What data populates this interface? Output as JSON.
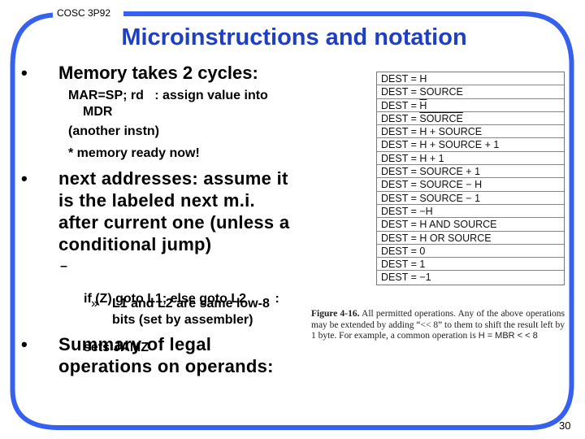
{
  "header": {
    "course": "COSC 3P92",
    "title": "Microinstructions and notation"
  },
  "colors": {
    "frame": "#3660f0",
    "title": "#1f3fbf"
  },
  "bullets": [
    {
      "marker": "•",
      "lines": [
        "Memory takes 2 cycles:"
      ],
      "sub": [
        {
          "lines": [
            "MAR=SP; rd   : assign value into",
            "   MDR"
          ]
        },
        {
          "lines": [
            "(another instn)"
          ]
        },
        {
          "lines": [
            "* memory ready now!"
          ]
        }
      ]
    },
    {
      "marker": "•",
      "lines": [
        "next addresses: assume it",
        "is the labeled next m.i.",
        "after current one (unless a",
        "conditional jump)"
      ],
      "sub": [
        {
          "marker": "–",
          "lines": [
            "if (Z) goto L1; else goto L2        :",
            "sets JAMZ"
          ]
        },
        {
          "marker": "»",
          "lines": [
            "L1 and L2 are same low-8",
            "bits (set by assembler)"
          ]
        }
      ]
    },
    {
      "marker": "•",
      "lines": [
        "Summary of legal",
        "operations on operands:"
      ]
    }
  ],
  "figure": {
    "operations": [
      {
        "prefix": "DEST = ",
        "expr": "H",
        "overline": false
      },
      {
        "prefix": "DEST = ",
        "expr": "SOURCE",
        "overline": false
      },
      {
        "prefix": "DEST = ",
        "expr": "H",
        "overline": true
      },
      {
        "prefix": "DEST = ",
        "expr": "SOURCE",
        "overline": true
      },
      {
        "prefix": "DEST = ",
        "expr": "H + SOURCE",
        "overline": false
      },
      {
        "prefix": "DEST = ",
        "expr": "H + SOURCE + 1",
        "overline": false
      },
      {
        "prefix": "DEST = ",
        "expr": "H + 1",
        "overline": false
      },
      {
        "prefix": "DEST = ",
        "expr": "SOURCE + 1",
        "overline": false
      },
      {
        "prefix": "DEST = ",
        "expr": "SOURCE − H",
        "overline": false
      },
      {
        "prefix": "DEST = ",
        "expr": "SOURCE − 1",
        "overline": false
      },
      {
        "prefix": "DEST = ",
        "expr": "−H",
        "overline": false
      },
      {
        "prefix": "DEST = ",
        "expr": "H AND SOURCE",
        "overline": false
      },
      {
        "prefix": "DEST = ",
        "expr": "H OR SOURCE",
        "overline": false
      },
      {
        "prefix": "DEST = ",
        "expr": "0",
        "overline": false
      },
      {
        "prefix": "DEST = ",
        "expr": "1",
        "overline": false
      },
      {
        "prefix": "DEST = ",
        "expr": "−1",
        "overline": false
      }
    ],
    "caption_label": "Figure 4-16.",
    "caption_text": " All permitted operations.  Any of the above operations may be extended by adding “<< 8” to them to shift the result left by 1 byte.  For example, a common operation is ",
    "caption_example": "H = MBR < < 8"
  },
  "footer": {
    "page_number": "30"
  }
}
